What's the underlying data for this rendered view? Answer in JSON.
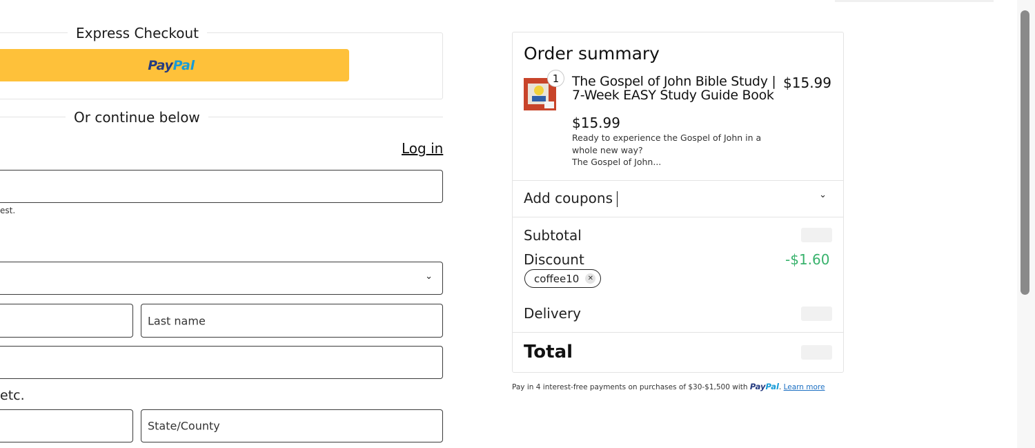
{
  "checkout": {
    "express_title": "Express Checkout",
    "paypal_part1": "Pay",
    "paypal_part2": "Pal",
    "or_continue": "Or continue below",
    "login": "Log in",
    "email_note": "est.",
    "last_name_placeholder": "Last name",
    "address_note": "etc.",
    "state_placeholder": "State/County"
  },
  "summary": {
    "title": "Order summary",
    "item": {
      "quantity": "1",
      "name": "The Gospel of John Bible Study | 7-Week EASY Study Guide Book",
      "unit_price": "$15.99",
      "line_price": "$15.99",
      "description_line1": "Ready to experience the Gospel of John in a",
      "description_line2": "whole new way?",
      "description_line3": "The Gospel of John..."
    },
    "coupons_label": "Add coupons",
    "subtotal_label": "Subtotal",
    "discount_label": "Discount",
    "discount_value": "-$1.60",
    "coupon_code": "coffee10",
    "delivery_label": "Delivery",
    "total_label": "Total"
  },
  "paylater": {
    "text": "Pay in 4 interest-free payments on purchases of $30-$1,500 with",
    "logo_part1": "Pay",
    "logo_part2": "Pal",
    "learn_more": "Learn more"
  },
  "icons": {
    "chevron": "chevron-down-icon",
    "remove": "close-icon"
  },
  "colors": {
    "paypal_button": "#fec13a",
    "paypal_dark": "#253b80",
    "paypal_light": "#179bd7",
    "discount": "#38b26c",
    "link": "#1a6ec2"
  }
}
